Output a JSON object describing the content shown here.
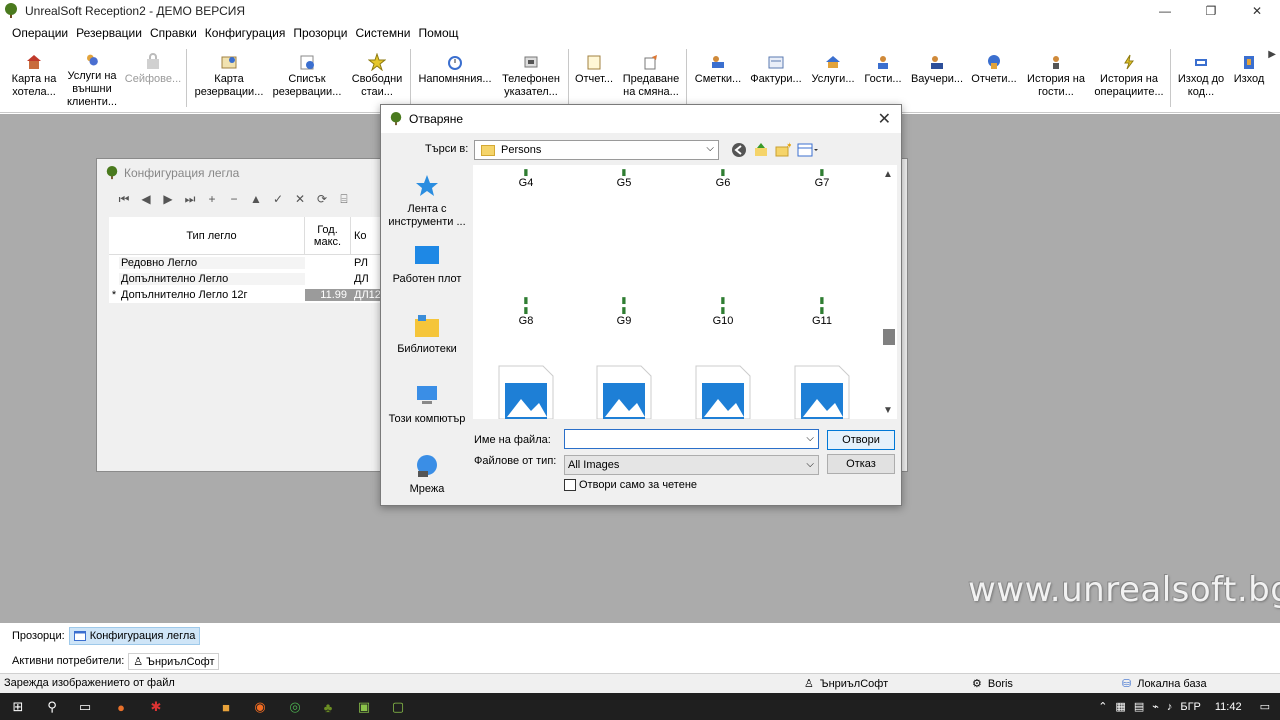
{
  "app": {
    "title": "UnrealSoft Reception2 - ДЕМО ВЕРСИЯ",
    "buttons": {
      "minimize": "—",
      "maximize": "❐",
      "close": "✕"
    }
  },
  "menu": [
    "Операции",
    "Резервации",
    "Справки",
    "Конфигурация",
    "Прозорци",
    "Системни",
    "Помощ"
  ],
  "toolbar": [
    {
      "label": "Карта на хотела...",
      "icon": "hotel-map-icon"
    },
    {
      "label": "Услуги на външни клиенти...",
      "icon": "external-services-icon"
    },
    {
      "label": "Сейфове...",
      "icon": "safe-icon",
      "disabled": true
    },
    {
      "label": "Карта резервации...",
      "icon": "reservation-map-icon"
    },
    {
      "label": "Списък резервации...",
      "icon": "reservation-list-icon"
    },
    {
      "label": "Свободни стаи...",
      "icon": "free-rooms-icon"
    },
    {
      "label": "Напомняния...",
      "icon": "reminders-icon"
    },
    {
      "label": "Телефонен указател...",
      "icon": "phonebook-icon"
    },
    {
      "label": "Отчет...",
      "icon": "report-icon"
    },
    {
      "label": "Предаване на смяна...",
      "icon": "shift-handover-icon"
    },
    {
      "label": "Сметки...",
      "icon": "bills-icon"
    },
    {
      "label": "Фактури...",
      "icon": "invoices-icon"
    },
    {
      "label": "Услуги...",
      "icon": "services-icon"
    },
    {
      "label": "Гости...",
      "icon": "guests-icon"
    },
    {
      "label": "Ваучери...",
      "icon": "vouchers-icon"
    },
    {
      "label": "Отчети...",
      "icon": "reports-icon"
    },
    {
      "label": "История на гости...",
      "icon": "guest-history-icon"
    },
    {
      "label": "История на операциите...",
      "icon": "operation-history-icon"
    },
    {
      "label": "Изход до код...",
      "icon": "logout-code-icon"
    },
    {
      "label": "Изход",
      "icon": "exit-icon"
    }
  ],
  "beds_window": {
    "title": "Конфигурация легла",
    "columns": [
      "Тип легло",
      "Год. макс.",
      "Ко"
    ],
    "rows": [
      {
        "indicator": "",
        "name": "Редовно Легло",
        "max": "",
        "code": "РЛ"
      },
      {
        "indicator": "",
        "name": "Допълнително Легло",
        "max": "",
        "code": "ДЛ"
      },
      {
        "indicator": "*",
        "name": "Допълнително Легло 12г",
        "max": "11.99",
        "code": "ДЛ12"
      }
    ],
    "nav": [
      "⏮",
      "◀",
      "▶",
      "⏭",
      "+",
      "−",
      "▲",
      "✓",
      "✕",
      "⟳",
      "⌸"
    ]
  },
  "open_dialog": {
    "title": "Отваряне",
    "look_in_label": "Търси в:",
    "look_in_value": "Persons",
    "places": [
      "Лента с инструменти ...",
      "Работен плот",
      "Библиотеки",
      "Този компютър",
      "Мрежа"
    ],
    "files_row1": [
      "G4",
      "G5",
      "G6",
      "G7"
    ],
    "files_row2": [
      "G8",
      "G9",
      "G10",
      "G11"
    ],
    "file_name_label": "Име на файла:",
    "file_name_value": "",
    "file_type_label": "Файлове от тип:",
    "file_type_value": "All Images",
    "open_button": "Отвори",
    "cancel_button": "Отказ",
    "readonly_label": "Отвори само за четене"
  },
  "windows_bar": {
    "label": "Прозорци:",
    "item": "Конфигурация легла"
  },
  "users_bar": {
    "label": "Активни потребители:",
    "user": "ЪнриълСофт"
  },
  "status": {
    "message": "Зарежда изображението от файл",
    "user": "ЪнриълСофт",
    "login": "Boris",
    "db": "Локална база"
  },
  "watermark": "www.unrealsoft.bg",
  "taskbar": {
    "lang": "БГР",
    "time": "11:42"
  }
}
